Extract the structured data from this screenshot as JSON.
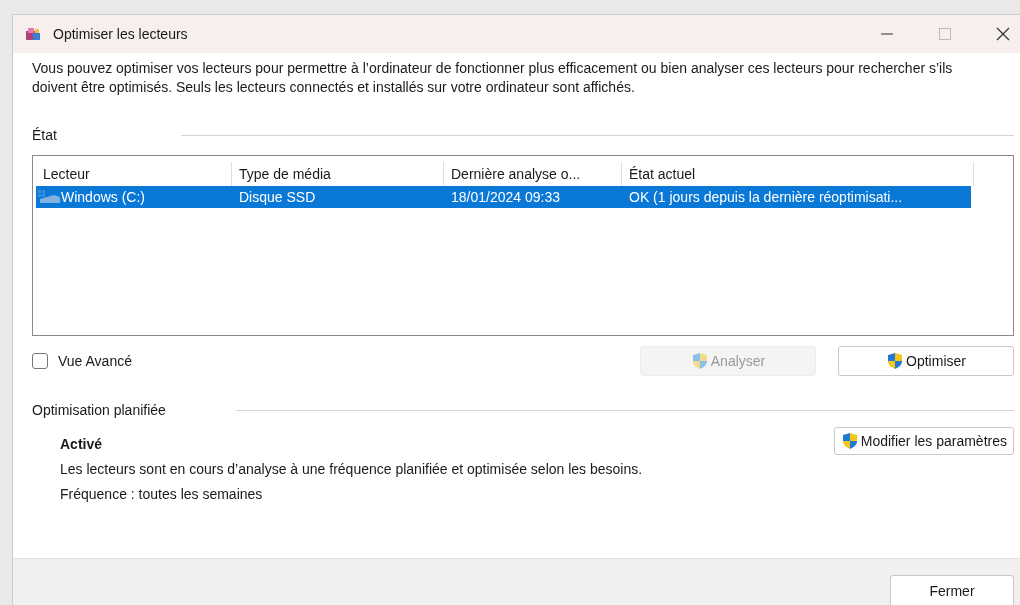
{
  "window": {
    "title": "Optimiser les lecteurs"
  },
  "description": "Vous pouvez optimiser vos lecteurs pour permettre à l’ordinateur de fonctionner plus efficacement ou bien analyser ces lecteurs pour rechercher s’ils doivent être optimisés. Seuls les lecteurs connectés et installés sur votre ordinateur sont affichés.",
  "state_section": {
    "label": "État"
  },
  "table": {
    "columns": [
      "Lecteur",
      "Type de média",
      "Dernière analyse o...",
      "État actuel"
    ],
    "rows": [
      {
        "drive": "Windows (C:)",
        "media_type": "Disque SSD",
        "last_analysis": "18/01/2024 09:33",
        "current_state": "OK (1 jours depuis la dernière réoptimisati...",
        "selected": true
      }
    ]
  },
  "advanced_view": {
    "label": "Vue Avancé",
    "checked": false
  },
  "buttons": [
    {
      "label": "Analyser",
      "disabled": true
    },
    {
      "label": "Optimiser",
      "disabled": false
    }
  ],
  "scheduled": {
    "label": "Optimisation planifiée",
    "status": "Activé",
    "description": "Les lecteurs sont en cours d’analyse à une fréquence planifiée et optimisée selon les besoins.",
    "frequency": "Fréquence : toutes les semaines",
    "button": "Modifier les paramètres"
  },
  "footer": {
    "close_button": "Fermer"
  }
}
